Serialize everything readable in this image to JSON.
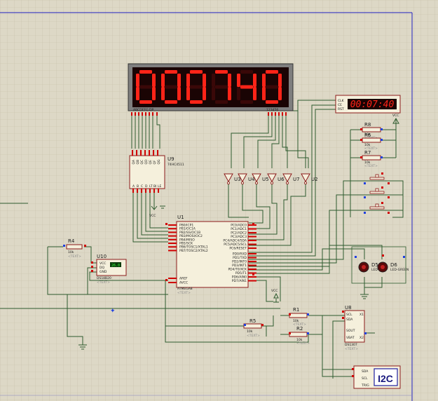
{
  "display": {
    "value": "000740",
    "left_labels": "ABCDEFG DP",
    "right_labels": "123456"
  },
  "rtc_display": {
    "value": "00:07:40",
    "pins": [
      "CLK",
      "CE",
      "RST"
    ]
  },
  "u9": {
    "ref": "U9",
    "part": "74HC4511",
    "pins_top": [
      "QA",
      "QB",
      "QC",
      "QD",
      "QE",
      "QF",
      "QG"
    ],
    "pins_bottom": [
      "A",
      "B",
      "C",
      "D",
      "LT",
      "BI",
      "LE"
    ],
    "vcc": "VCC"
  },
  "u1": {
    "ref": "U1",
    "part": "ATMEGA8",
    "text": "<TEXT>",
    "left_pins": [
      "PB0/ICP1",
      "PB1/OC1A",
      "PB2/SS/OC1B",
      "PB3/MOSI/OC2",
      "PB4/MISO",
      "PB5/SCK",
      "PB6/TOSC1/XTAL1",
      "PB7/TOSC2/XTAL2"
    ],
    "left_low": [
      "AREF",
      "AVCC"
    ],
    "right_pins": [
      "PC0/ADC0",
      "PC1/ADC1",
      "PC2/ADC2",
      "PC3/ADC3",
      "PC4/ADC4/SDA",
      "PC5/ADC5/SCL",
      "PC6/RESET"
    ],
    "right_low": [
      "PD0/RXD",
      "PD1/TXD",
      "PD2/INT0",
      "PD3/INT1",
      "PD4/T0/XCK",
      "PD5/T1",
      "PD6/AIN0",
      "PD7/AIN1"
    ]
  },
  "inverters": [
    "U3",
    "U4",
    "U5",
    "U6",
    "U7",
    "U2"
  ],
  "resistors": [
    {
      "ref": "R8",
      "value": "10k"
    },
    {
      "ref": "R6",
      "value": "10k"
    },
    {
      "ref": "R7",
      "value": "10k"
    },
    {
      "ref": "R4",
      "value": "10k"
    },
    {
      "ref": "R1",
      "value": "10k"
    },
    {
      "ref": "R2",
      "value": "10k"
    },
    {
      "ref": "R5",
      "value": "10k"
    }
  ],
  "u10": {
    "ref": "U10",
    "part": "DS18B20",
    "pins": [
      "VCC",
      "DQ",
      "GND"
    ],
    "reading": "26.0"
  },
  "leds": [
    {
      "ref": "D5",
      "part": "LED-BLUE"
    },
    {
      "ref": "D6",
      "part": "LED-GREEN"
    }
  ],
  "u8": {
    "ref": "U8",
    "part": "DS1307",
    "pins": [
      "SCL",
      "SDA",
      "SOUT",
      "VBAT",
      "X1",
      "X2"
    ]
  },
  "i2c": {
    "label": "I2C",
    "pins": [
      "SDA",
      "SCL",
      "TRIG"
    ]
  },
  "power": {
    "vcc": "VCC"
  },
  "text_placeholder": "<TEXT>",
  "colors": {
    "segment_on": "#ff2418",
    "segment_bg": "#3a0808",
    "display_frame": "#7f7f7f",
    "wire": "#2d5a2d",
    "pin_red": "#d00000",
    "pin_blue": "#2040e0",
    "background": "#ddd8c6",
    "chip_fill": "#f5f0dc",
    "chip_border": "#8b1a1a"
  }
}
